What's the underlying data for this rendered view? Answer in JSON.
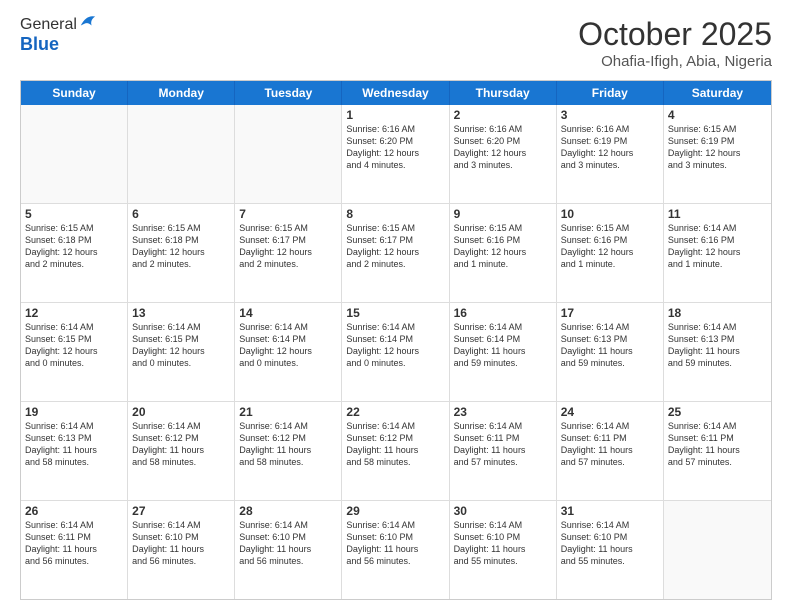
{
  "logo": {
    "line1": "General",
    "line2": "Blue"
  },
  "title": "October 2025",
  "subtitle": "Ohafia-Ifigh, Abia, Nigeria",
  "header_days": [
    "Sunday",
    "Monday",
    "Tuesday",
    "Wednesday",
    "Thursday",
    "Friday",
    "Saturday"
  ],
  "rows": [
    [
      {
        "day": "",
        "text": "",
        "empty": true
      },
      {
        "day": "",
        "text": "",
        "empty": true
      },
      {
        "day": "",
        "text": "",
        "empty": true
      },
      {
        "day": "1",
        "text": "Sunrise: 6:16 AM\nSunset: 6:20 PM\nDaylight: 12 hours\nand 4 minutes."
      },
      {
        "day": "2",
        "text": "Sunrise: 6:16 AM\nSunset: 6:20 PM\nDaylight: 12 hours\nand 3 minutes."
      },
      {
        "day": "3",
        "text": "Sunrise: 6:16 AM\nSunset: 6:19 PM\nDaylight: 12 hours\nand 3 minutes."
      },
      {
        "day": "4",
        "text": "Sunrise: 6:15 AM\nSunset: 6:19 PM\nDaylight: 12 hours\nand 3 minutes."
      }
    ],
    [
      {
        "day": "5",
        "text": "Sunrise: 6:15 AM\nSunset: 6:18 PM\nDaylight: 12 hours\nand 2 minutes."
      },
      {
        "day": "6",
        "text": "Sunrise: 6:15 AM\nSunset: 6:18 PM\nDaylight: 12 hours\nand 2 minutes."
      },
      {
        "day": "7",
        "text": "Sunrise: 6:15 AM\nSunset: 6:17 PM\nDaylight: 12 hours\nand 2 minutes."
      },
      {
        "day": "8",
        "text": "Sunrise: 6:15 AM\nSunset: 6:17 PM\nDaylight: 12 hours\nand 2 minutes."
      },
      {
        "day": "9",
        "text": "Sunrise: 6:15 AM\nSunset: 6:16 PM\nDaylight: 12 hours\nand 1 minute."
      },
      {
        "day": "10",
        "text": "Sunrise: 6:15 AM\nSunset: 6:16 PM\nDaylight: 12 hours\nand 1 minute."
      },
      {
        "day": "11",
        "text": "Sunrise: 6:14 AM\nSunset: 6:16 PM\nDaylight: 12 hours\nand 1 minute."
      }
    ],
    [
      {
        "day": "12",
        "text": "Sunrise: 6:14 AM\nSunset: 6:15 PM\nDaylight: 12 hours\nand 0 minutes."
      },
      {
        "day": "13",
        "text": "Sunrise: 6:14 AM\nSunset: 6:15 PM\nDaylight: 12 hours\nand 0 minutes."
      },
      {
        "day": "14",
        "text": "Sunrise: 6:14 AM\nSunset: 6:14 PM\nDaylight: 12 hours\nand 0 minutes."
      },
      {
        "day": "15",
        "text": "Sunrise: 6:14 AM\nSunset: 6:14 PM\nDaylight: 12 hours\nand 0 minutes."
      },
      {
        "day": "16",
        "text": "Sunrise: 6:14 AM\nSunset: 6:14 PM\nDaylight: 11 hours\nand 59 minutes."
      },
      {
        "day": "17",
        "text": "Sunrise: 6:14 AM\nSunset: 6:13 PM\nDaylight: 11 hours\nand 59 minutes."
      },
      {
        "day": "18",
        "text": "Sunrise: 6:14 AM\nSunset: 6:13 PM\nDaylight: 11 hours\nand 59 minutes."
      }
    ],
    [
      {
        "day": "19",
        "text": "Sunrise: 6:14 AM\nSunset: 6:13 PM\nDaylight: 11 hours\nand 58 minutes."
      },
      {
        "day": "20",
        "text": "Sunrise: 6:14 AM\nSunset: 6:12 PM\nDaylight: 11 hours\nand 58 minutes."
      },
      {
        "day": "21",
        "text": "Sunrise: 6:14 AM\nSunset: 6:12 PM\nDaylight: 11 hours\nand 58 minutes."
      },
      {
        "day": "22",
        "text": "Sunrise: 6:14 AM\nSunset: 6:12 PM\nDaylight: 11 hours\nand 58 minutes."
      },
      {
        "day": "23",
        "text": "Sunrise: 6:14 AM\nSunset: 6:11 PM\nDaylight: 11 hours\nand 57 minutes."
      },
      {
        "day": "24",
        "text": "Sunrise: 6:14 AM\nSunset: 6:11 PM\nDaylight: 11 hours\nand 57 minutes."
      },
      {
        "day": "25",
        "text": "Sunrise: 6:14 AM\nSunset: 6:11 PM\nDaylight: 11 hours\nand 57 minutes."
      }
    ],
    [
      {
        "day": "26",
        "text": "Sunrise: 6:14 AM\nSunset: 6:11 PM\nDaylight: 11 hours\nand 56 minutes."
      },
      {
        "day": "27",
        "text": "Sunrise: 6:14 AM\nSunset: 6:10 PM\nDaylight: 11 hours\nand 56 minutes."
      },
      {
        "day": "28",
        "text": "Sunrise: 6:14 AM\nSunset: 6:10 PM\nDaylight: 11 hours\nand 56 minutes."
      },
      {
        "day": "29",
        "text": "Sunrise: 6:14 AM\nSunset: 6:10 PM\nDaylight: 11 hours\nand 56 minutes."
      },
      {
        "day": "30",
        "text": "Sunrise: 6:14 AM\nSunset: 6:10 PM\nDaylight: 11 hours\nand 55 minutes."
      },
      {
        "day": "31",
        "text": "Sunrise: 6:14 AM\nSunset: 6:10 PM\nDaylight: 11 hours\nand 55 minutes."
      },
      {
        "day": "",
        "text": "",
        "empty": true
      }
    ]
  ]
}
